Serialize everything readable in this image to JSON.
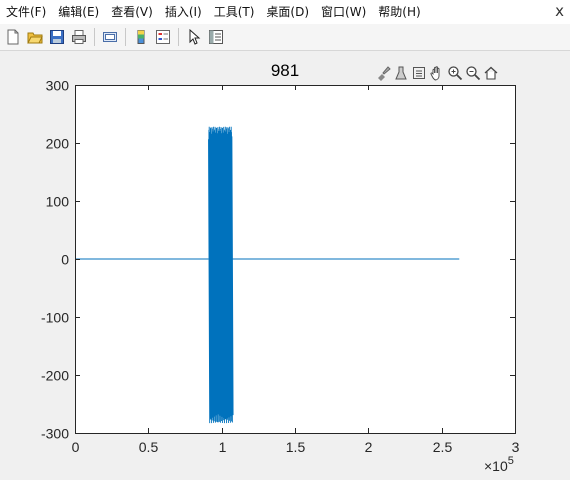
{
  "menu": {
    "items": [
      "文件(F)",
      "编辑(E)",
      "查看(V)",
      "插入(I)",
      "工具(T)",
      "桌面(D)",
      "窗口(W)",
      "帮助(H)"
    ],
    "close_glyph": "x"
  },
  "toolbar": {
    "icons": [
      "new-figure-icon",
      "open-file-icon",
      "save-icon",
      "print-icon",
      "link-plot-icon",
      "insert-colorbar-icon",
      "insert-legend-icon",
      "edit-plot-arrow-icon",
      "property-inspector-icon"
    ]
  },
  "axes_toolbar": {
    "icons": [
      "brush-icon",
      "data-tips-icon",
      "rotate-3d-icon",
      "pan-icon",
      "zoom-in-icon",
      "zoom-out-icon",
      "restore-view-icon"
    ]
  },
  "chart_data": {
    "type": "line",
    "title": "981",
    "xlabel": "",
    "ylabel": "",
    "xlim": [
      0,
      3
    ],
    "ylim": [
      -300,
      300
    ],
    "x_multiplier": "×10",
    "x_multiplier_exponent": "5",
    "xticks": [
      "0",
      "0.5",
      "1",
      "1.5",
      "2",
      "2.5",
      "3"
    ],
    "yticks": [
      "300",
      "200",
      "100",
      "0",
      "-100",
      "-200",
      "-300"
    ],
    "line_color": "#0072bd",
    "grid": false,
    "series": [
      {
        "x_start": 0,
        "x_end": 2.62,
        "baseline": 0,
        "burst_start": 0.91,
        "burst_end": 1.07,
        "burst_upper_peak": 228,
        "burst_lower_peak": -283,
        "burst_dense_upper": 180,
        "burst_dense_lower": -210
      }
    ]
  }
}
